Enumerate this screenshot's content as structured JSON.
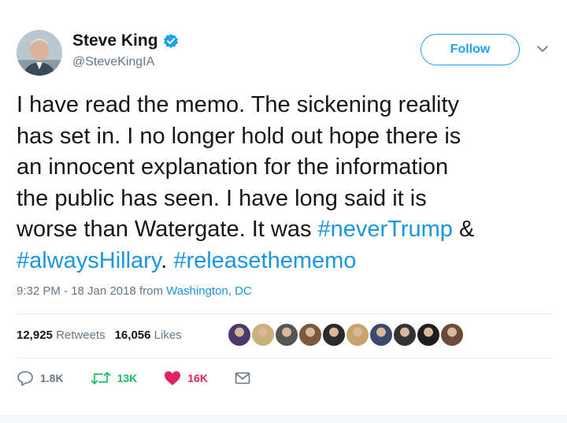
{
  "user": {
    "name": "Steve King",
    "handle": "@SteveKingIA",
    "verified": true,
    "avatar": "profile-photo"
  },
  "follow_button": {
    "label": "Follow"
  },
  "menu": {
    "icon": "chevron-down-icon"
  },
  "tweet": {
    "lines": [
      [
        {
          "text": "I have read the memo. The sickening reality"
        }
      ],
      [
        {
          "text": "has set in. I no longer hold out hope there is"
        }
      ],
      [
        {
          "text": "an innocent explanation for the information"
        }
      ],
      [
        {
          "text": "the public has seen. I have long said it is"
        }
      ],
      [
        {
          "text": "worse than Watergate. It was "
        },
        {
          "text": "#neverTrump",
          "hashtag": true
        },
        {
          "text": " &"
        }
      ],
      [
        {
          "text": "#alwaysHillary",
          "hashtag": true
        },
        {
          "text": ". "
        },
        {
          "text": "#releasethememo",
          "hashtag": true
        }
      ]
    ]
  },
  "meta": {
    "time": "9:32 PM - 18 Jan 2018",
    "from_label": "from",
    "location": "Washington, DC"
  },
  "stats": {
    "retweets_count": "12,925",
    "retweets_label": "Retweets",
    "likes_count": "16,056",
    "likes_label": "Likes"
  },
  "likers": [
    {
      "color": "#4a3a6b"
    },
    {
      "color": "#c9b27a"
    },
    {
      "color": "#555555"
    },
    {
      "color": "#7a5a3a"
    },
    {
      "color": "#2b2b2b"
    },
    {
      "color": "#c8a46a"
    },
    {
      "color": "#3a4a6b"
    },
    {
      "color": "#333333"
    },
    {
      "color": "#1e1e1e"
    },
    {
      "color": "#6b4a3a"
    }
  ],
  "actions": {
    "reply": {
      "icon": "reply-icon",
      "count": "1.8K"
    },
    "retweet": {
      "icon": "retweet-icon",
      "count": "13K"
    },
    "like": {
      "icon": "heart-icon",
      "count": "16K"
    },
    "message": {
      "icon": "envelope-icon"
    }
  },
  "colors": {
    "accent": "#1da1f2",
    "link": "#1b95e0",
    "retweet": "#17bf63",
    "like": "#e0245e",
    "secondary_text": "#657786"
  }
}
